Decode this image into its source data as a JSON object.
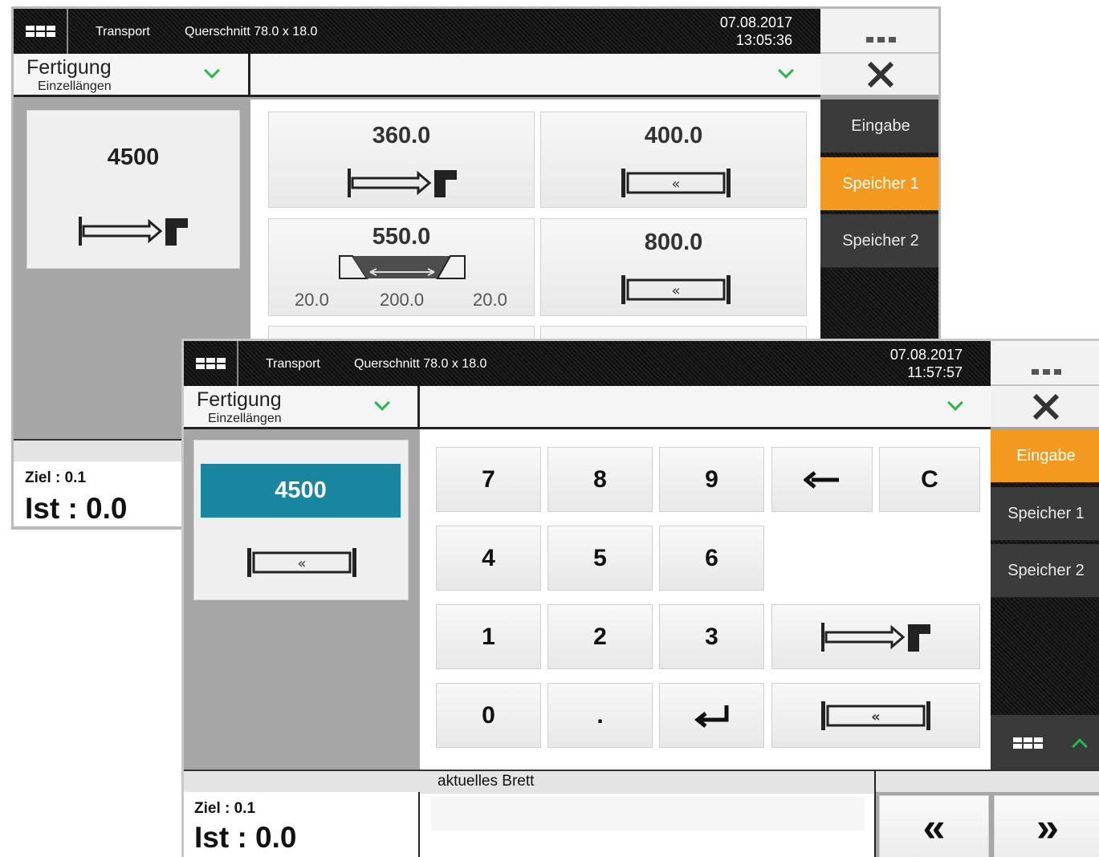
{
  "back_window": {
    "topbar": {
      "menu_icon": "grid-icon",
      "section": "Transport",
      "cross_section": "Querschnitt 78.0 x 18.0",
      "date": "07.08.2017",
      "time": "13:05:36",
      "more_icon": "dots-icon"
    },
    "selector": {
      "title": "Fertigung",
      "subtitle": "Einzellängen",
      "dropdown_icon": "chevron-down-icon",
      "dropdown2_icon": "chevron-down-icon",
      "close_icon": "close-icon"
    },
    "current_length": "4500",
    "current_mode_icon": "push-to-stop-icon",
    "tiles": [
      {
        "value": "360.0",
        "icon": "push-to-stop-icon"
      },
      {
        "value": "400.0",
        "icon": "centered-cut-icon"
      },
      {
        "value": "550.0",
        "icon": "trapezoid-cut-icon",
        "sub_left": "20.0",
        "sub_mid": "200.0",
        "sub_right": "20.0"
      },
      {
        "value": "800.0",
        "icon": "centered-cut-icon"
      }
    ],
    "sidebar": [
      {
        "label": "Eingabe",
        "active": false
      },
      {
        "label": "Speicher 1",
        "active": true
      },
      {
        "label": "Speicher 2",
        "active": false
      }
    ],
    "status": {
      "ziel": "Ziel : 0.1",
      "ist": "Ist : 0.0"
    }
  },
  "front_window": {
    "topbar": {
      "menu_icon": "grid-icon",
      "section": "Transport",
      "cross_section": "Querschnitt 78.0 x 18.0",
      "date": "07.08.2017",
      "time": "11:57:57",
      "more_icon": "dots-icon"
    },
    "selector": {
      "title": "Fertigung",
      "subtitle": "Einzellängen",
      "dropdown_icon": "chevron-down-icon",
      "dropdown2_icon": "chevron-down-icon",
      "close_icon": "close-icon"
    },
    "input_value": "4500",
    "input_mode_icon": "centered-cut-icon",
    "keypad": {
      "k7": "7",
      "k8": "8",
      "k9": "9",
      "backspace_icon": "backspace-arrow-icon",
      "clear": "C",
      "k4": "4",
      "k5": "5",
      "k6": "6",
      "k1": "1",
      "k2": "2",
      "k3": "3",
      "mode_stop_icon": "push-to-stop-icon",
      "k0": "0",
      "dot": ".",
      "enter_icon": "enter-icon",
      "mode_center_icon": "centered-cut-icon"
    },
    "sidebar": [
      {
        "label": "Eingabe",
        "active": true
      },
      {
        "label": "Speicher 1",
        "active": false
      },
      {
        "label": "Speicher 2",
        "active": false
      }
    ],
    "sidebar_footer": {
      "keyboard_icon": "keyboard-icon",
      "expand_icon": "chevron-up-icon"
    },
    "status": {
      "ziel": "Ziel : 0.1",
      "ist": "Ist : 0.0"
    },
    "current_board_label": "aktuelles Brett",
    "nav": {
      "prev": "«",
      "next": "»"
    }
  },
  "colors": {
    "accent_orange": "#f39a1e",
    "input_teal": "#17869e",
    "chevron_green": "#27b84a",
    "dark_bar": "#131313"
  }
}
